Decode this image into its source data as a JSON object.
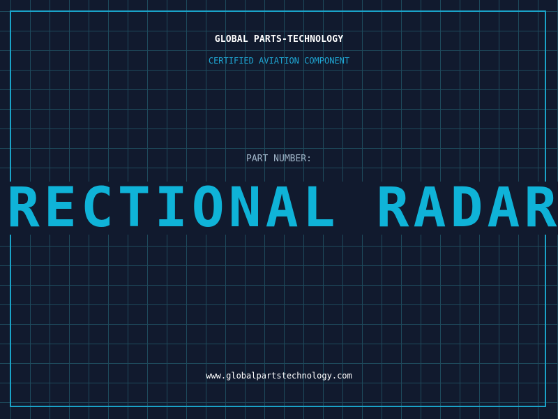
{
  "header": {
    "company": "GLOBAL PARTS-TECHNOLOGY",
    "subtitle": "CERTIFIED AVIATION COMPONENT"
  },
  "part": {
    "label": "PART NUMBER:",
    "value": "DIRECTIONAL RADAR SYSTEM"
  },
  "footer": {
    "website": "www.globalpartstechnology.com"
  },
  "colors": {
    "background": "#111a2e",
    "grid": "#1e4a5c",
    "accent": "#0fb3d8",
    "frame": "#1aa3c8"
  }
}
